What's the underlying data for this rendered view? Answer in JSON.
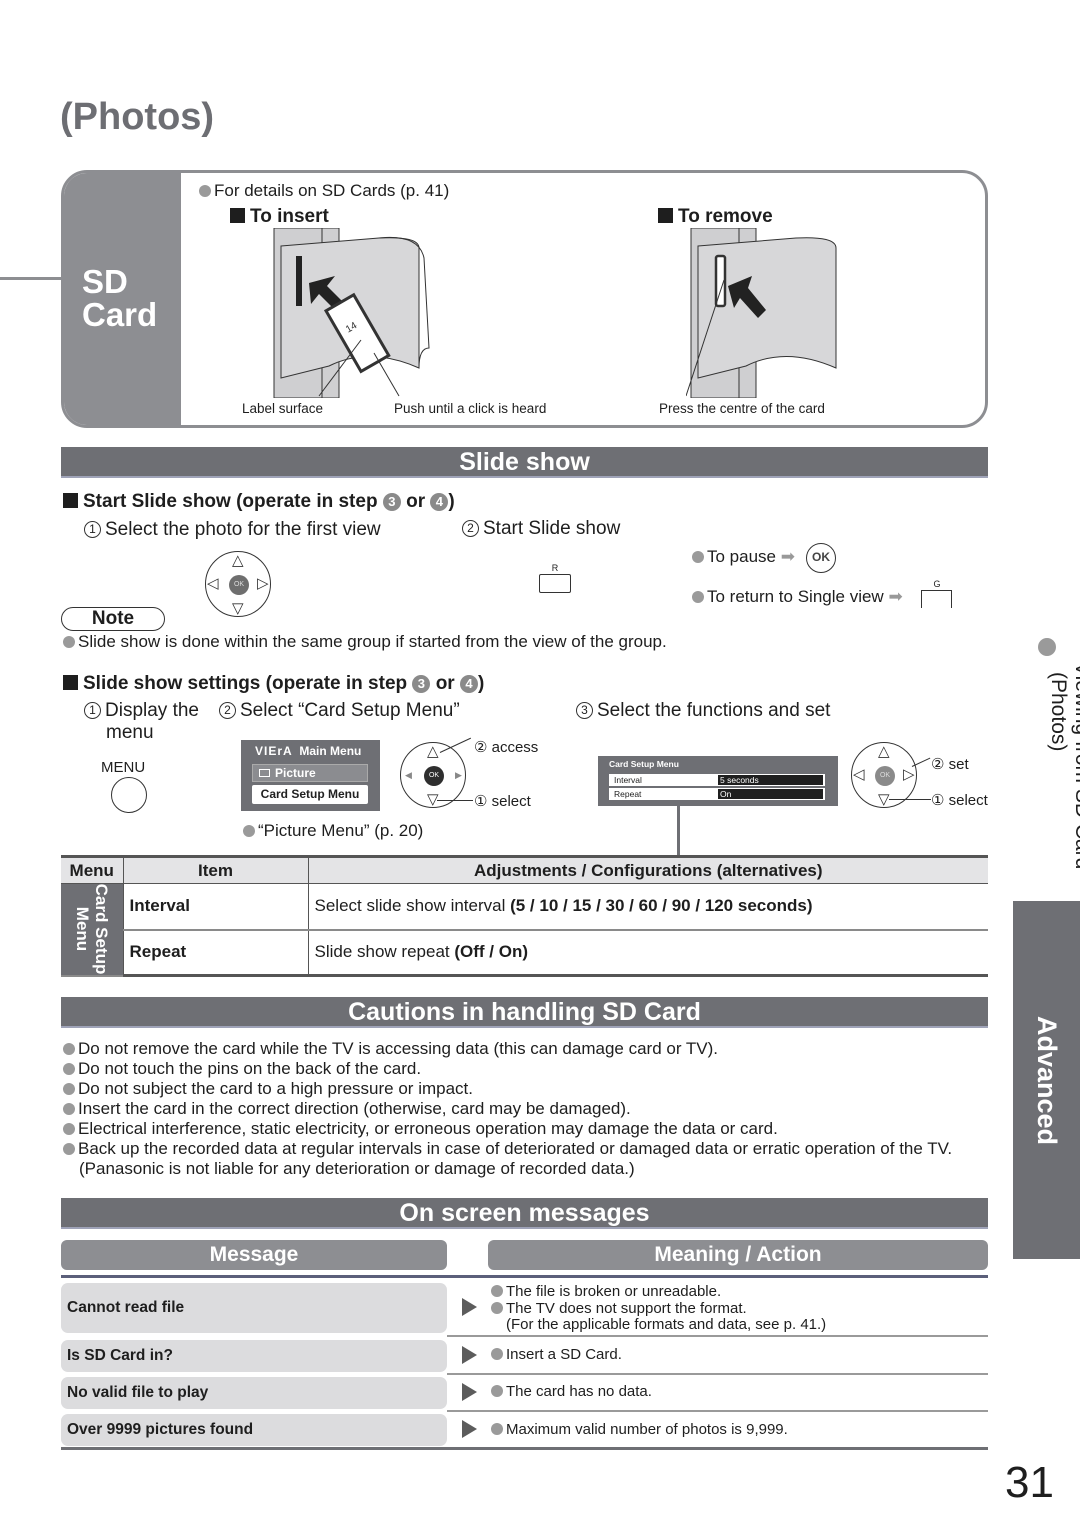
{
  "page": {
    "title": "(Photos)",
    "page_number": "31"
  },
  "sd_card": {
    "tab_label_line1": "SD",
    "tab_label_line2": "Card",
    "details": "For details on SD Cards (p. 41)",
    "insert_title": "To insert",
    "remove_title": "To remove",
    "captions": {
      "label_surface": "Label surface",
      "push": "Push until a click is heard",
      "press": "Press the centre of the card"
    },
    "illustration_icons": [
      "sd-card-insert-illustration",
      "sd-card-remove-illustration"
    ]
  },
  "slide_show": {
    "banner": "Slide show",
    "start": {
      "heading_prefix": "Start Slide show (operate in step",
      "step_a": "3",
      "heading_or": "or",
      "step_b": "4",
      "heading_suffix": ")",
      "step1_num": "1",
      "step1": "Select the photo for the first view",
      "step2_num": "2",
      "step2": "Start Slide show",
      "red_key_label": "R",
      "pause_text": "To pause",
      "pause_key": "OK",
      "return_text": "To return to Single view",
      "green_key_label": "G"
    },
    "note": {
      "label": "Note",
      "text": "Slide show is done within the same group if started from the view of the group."
    },
    "settings": {
      "heading_prefix": "Slide show settings (operate in step",
      "step_a": "3",
      "heading_or": "or",
      "step_b": "4",
      "heading_suffix": ")",
      "step1_num": "1",
      "step1_line1": "Display the",
      "step1_line2": "menu",
      "menu_key_label": "MENU",
      "step2_num": "2",
      "step2": "Select “Card Setup Menu”",
      "main_menu": {
        "brand": "VIErA",
        "title": "Main Menu",
        "item_picture": "Picture",
        "item_card_setup": "Card Setup Menu"
      },
      "access_label": "② access",
      "select_label": "① select",
      "picture_menu_ref": "“Picture Menu” (p. 20)",
      "step3_num": "3",
      "step3": "Select the functions and set",
      "card_menu": {
        "title": "Card Setup Menu",
        "rows": [
          {
            "label": "Interval",
            "value": "5 seconds"
          },
          {
            "label": "Repeat",
            "value": "On"
          }
        ]
      },
      "set_label": "② set",
      "select_label2": "① select"
    },
    "table": {
      "headers": [
        "Menu",
        "Item",
        "Adjustments / Configurations (alternatives)"
      ],
      "menu_group_line1": "Card Setup",
      "menu_group_line2": "Menu",
      "rows": [
        {
          "item": "Interval",
          "desc_plain": "Select slide show interval ",
          "desc_bold": "(5 / 10 / 15 / 30 / 60 / 90 / 120 seconds)"
        },
        {
          "item": "Repeat",
          "desc_plain": "Slide show repeat ",
          "desc_bold": "(Off / On)"
        }
      ]
    }
  },
  "cautions": {
    "banner": "Cautions in handling SD Card",
    "items": [
      "Do not remove the card while the TV is accessing data (this can damage card or TV).",
      "Do not touch the pins on the back of the card.",
      "Do not subject the card to a high pressure or impact.",
      "Insert the card in the correct direction (otherwise, card may be damaged).",
      "Electrical interference, static electricity, or erroneous operation may damage the data or card.",
      "Back up the recorded data at regular intervals in case of deteriorated or damaged data or erratic operation of the TV. (Panasonic is not liable for any deterioration or damage of recorded data.)"
    ]
  },
  "messages": {
    "banner": "On screen messages",
    "head_message": "Message",
    "head_meaning": "Meaning / Action",
    "rows": [
      {
        "message": "Cannot read file",
        "lines": [
          "The file is broken or unreadable.",
          "The TV does not support the format.",
          "(For the applicable formats and data, see p. 41.)"
        ]
      },
      {
        "message": "Is SD Card in?",
        "lines": [
          "Insert a SD Card."
        ]
      },
      {
        "message": "No valid file to play",
        "lines": [
          "The card has no data."
        ]
      },
      {
        "message": "Over 9999 pictures found",
        "lines": [
          "Maximum valid number of photos is 9,999."
        ]
      }
    ]
  },
  "side": {
    "viewing_line1": "Viewing from SD Card",
    "viewing_line2": "(Photos)",
    "advanced": "Advanced"
  },
  "colors": {
    "banner": "#6e6f74",
    "tab_grey": "#8d8e92",
    "bullet": "#9a9a9a"
  }
}
